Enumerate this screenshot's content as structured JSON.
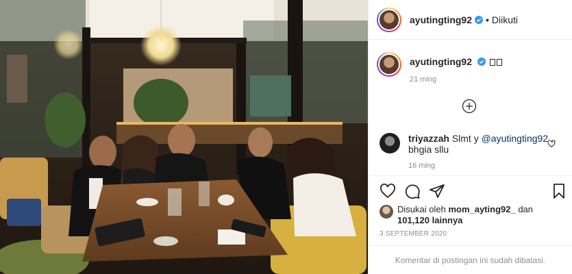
{
  "post": {
    "username": "ayutingting92",
    "follow_state": "Diikuti",
    "separator": "•",
    "caption_user": "ayutingting92",
    "caption_time": "21 ming",
    "photo_icon_label": "heart-eyes emoji pair"
  },
  "comment": {
    "user": "triyazzah",
    "text_before": "Slmt y ",
    "mention": "@ayutingting92",
    "text_after": ",, bhgia sllu",
    "time": "16 ming"
  },
  "likes": {
    "prefix": "Disukai oleh ",
    "user": "mom_ayting92_",
    "mid": " dan",
    "count": "101,120",
    "suffix": " lainnya"
  },
  "date": "3 SEPTEMBER 2020",
  "footer": "Komentar di postingan ini sudah dibatasi.",
  "colors": {
    "verified": "#3897f0",
    "text": "#262626",
    "muted": "#8e8e8e",
    "mention": "#00376b",
    "border": "#efefef"
  }
}
